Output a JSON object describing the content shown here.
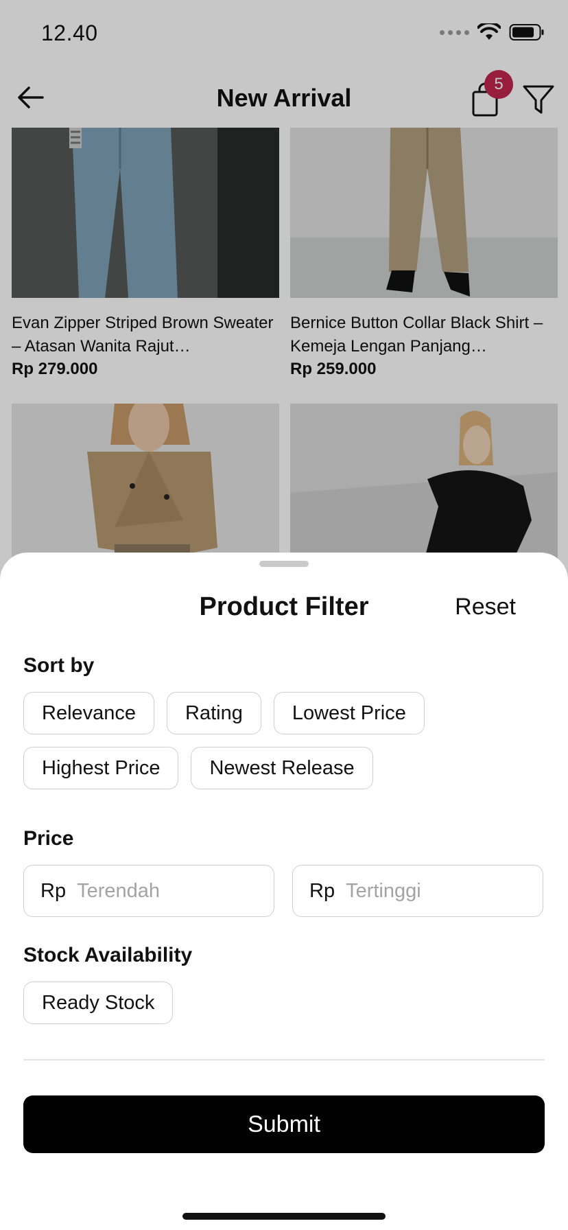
{
  "status_bar": {
    "time": "12.40",
    "icons": [
      "signal-icon",
      "wifi-icon",
      "battery-icon"
    ]
  },
  "nav": {
    "back_icon": "arrow-left-icon",
    "title": "New Arrival",
    "cart_icon": "shopping-bag-icon",
    "cart_badge": "5",
    "filter_icon": "filter-funnel-icon",
    "badge_color": "#c0264d"
  },
  "products": [
    {
      "name": "Evan Zipper Striped Brown Sweater – Atasan Wanita Rajut…",
      "price": "Rp 279.000"
    },
    {
      "name": "Bernice Button Collar Black Shirt – Kemeja Lengan Panjang…",
      "price": "Rp 259.000"
    },
    {
      "name": "",
      "price": ""
    },
    {
      "name": "",
      "price": ""
    }
  ],
  "filter_sheet": {
    "title": "Product Filter",
    "reset_label": "Reset",
    "sort_by": {
      "label": "Sort by",
      "options": [
        "Relevance",
        "Rating",
        "Lowest Price",
        "Highest Price",
        "Newest Release"
      ]
    },
    "price": {
      "label": "Price",
      "min_prefix": "Rp",
      "min_placeholder": "Terendah",
      "min_value": "",
      "max_prefix": "Rp",
      "max_placeholder": "Tertinggi",
      "max_value": ""
    },
    "stock": {
      "label": "Stock Availability",
      "options": [
        "Ready Stock"
      ]
    },
    "submit_label": "Submit"
  }
}
